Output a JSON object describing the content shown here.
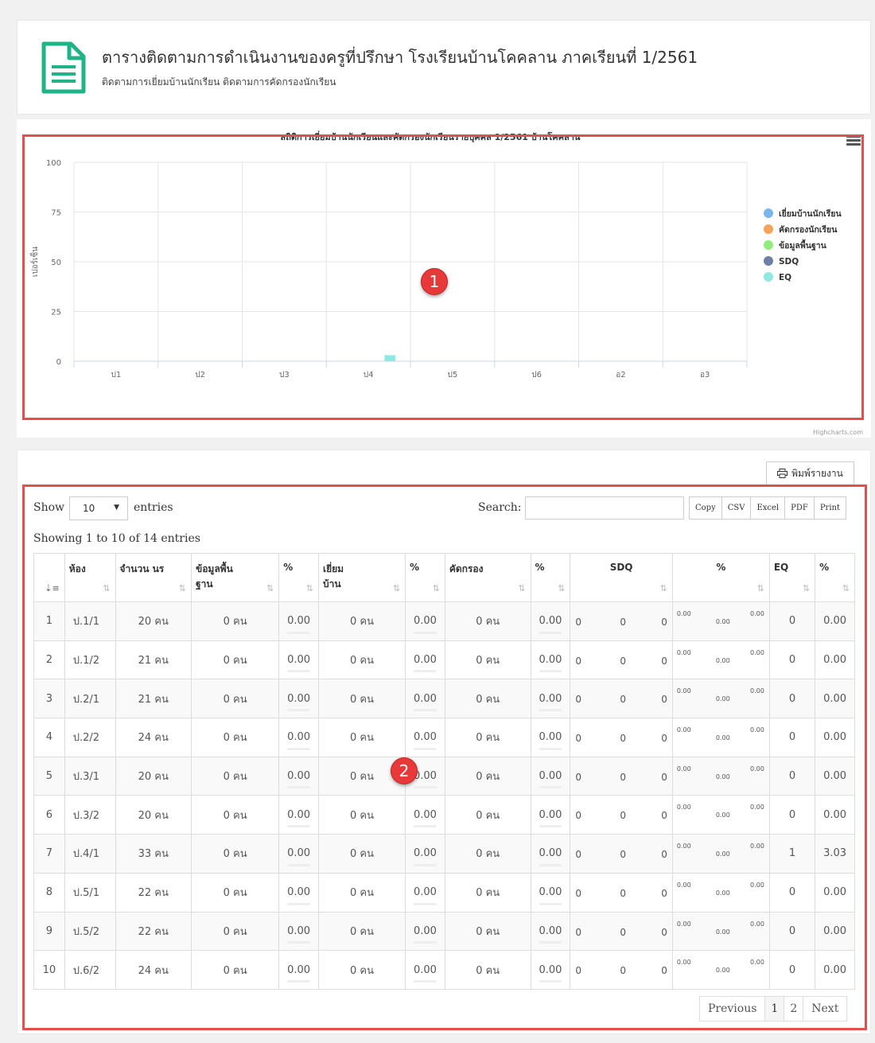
{
  "header": {
    "title": "ตารางติดตามการดำเนินงานของครูที่ปรึกษา โรงเรียนบ้านโคคลาน ภาคเรียนที่ 1/2561",
    "subtitle": "ติดตามการเยี่ยมบ้านนักเรียน ติดตามการคัดกรองนักเรียน",
    "icon": "document-icon",
    "icon_color": "#1fb387"
  },
  "chart_data": {
    "type": "bar",
    "title": "สถิติการเยี่ยมบ้านนักเรียนและคัดกรองนักเรียนรายบุคคล 1/2561 บ้านโคคลาน",
    "ylabel": "เปอร์เซ็น",
    "xlabel": "",
    "categories": [
      "ป1",
      "ป2",
      "ป3",
      "ป4",
      "ป5",
      "ป6",
      "อ2",
      "อ3"
    ],
    "ylim": [
      0,
      100
    ],
    "yticks": [
      0,
      25,
      50,
      75,
      100
    ],
    "grid": true,
    "legend_position": "right",
    "series": [
      {
        "name": "เยี่ยมบ้านนักเรียน",
        "color": "#7cb5ec",
        "values": [
          0,
          0,
          0,
          0,
          0,
          0,
          0,
          0
        ]
      },
      {
        "name": "คัดกรองนักเรียน",
        "color": "#f7a35c",
        "values": [
          0,
          0,
          0,
          0,
          0,
          0,
          0,
          0
        ]
      },
      {
        "name": "ข้อมูลพื้นฐาน",
        "color": "#90ed7d",
        "values": [
          0,
          0,
          0,
          0,
          0,
          0,
          0,
          0
        ]
      },
      {
        "name": "SDQ",
        "color": "#6d7fa3",
        "values": [
          0,
          0,
          0,
          0,
          0,
          0,
          0,
          0
        ]
      },
      {
        "name": "EQ",
        "color": "#91e8e1",
        "values": [
          0,
          0,
          0,
          3.03,
          0,
          0,
          0,
          0
        ]
      }
    ],
    "credits": "Highcharts.com"
  },
  "toolbar": {
    "print_report_label": "พิมพ์รายงาน",
    "show_label": "Show",
    "entries_value": "10",
    "entries_label": "entries",
    "search_label": "Search:",
    "search_value": "",
    "export_buttons": [
      "Copy",
      "CSV",
      "Excel",
      "PDF",
      "Print"
    ],
    "info": "Showing 1 to 10 of 14 entries"
  },
  "table": {
    "headers": {
      "no": "",
      "room": "ห้อง",
      "count": "จำนวน นร",
      "basic": "ข้อมูลพื้น ฐาน",
      "pct1": "%",
      "visit": "เยี่ยม บ้าน",
      "pct2": "%",
      "screen": "คัดกรอง",
      "pct3": "%",
      "sdq": "SDQ",
      "pct4": "%",
      "eq": "EQ",
      "pct5": "%"
    },
    "rows": [
      {
        "no": "1",
        "room": "ป.1/1",
        "count": "20 คน",
        "basic": "0 คน",
        "p1": "0.00",
        "visit": "0 คน",
        "p2": "0.00",
        "screen": "0 คน",
        "p3": "0.00",
        "sdq": [
          "0",
          "0",
          "0"
        ],
        "sdqp": [
          "0.00",
          "0.00",
          "0.00"
        ],
        "eq": "0",
        "eqp": "0.00"
      },
      {
        "no": "2",
        "room": "ป.1/2",
        "count": "21 คน",
        "basic": "0 คน",
        "p1": "0.00",
        "visit": "0 คน",
        "p2": "0.00",
        "screen": "0 คน",
        "p3": "0.00",
        "sdq": [
          "0",
          "0",
          "0"
        ],
        "sdqp": [
          "0.00",
          "0.00",
          "0.00"
        ],
        "eq": "0",
        "eqp": "0.00"
      },
      {
        "no": "3",
        "room": "ป.2/1",
        "count": "21 คน",
        "basic": "0 คน",
        "p1": "0.00",
        "visit": "0 คน",
        "p2": "0.00",
        "screen": "0 คน",
        "p3": "0.00",
        "sdq": [
          "0",
          "0",
          "0"
        ],
        "sdqp": [
          "0.00",
          "0.00",
          "0.00"
        ],
        "eq": "0",
        "eqp": "0.00"
      },
      {
        "no": "4",
        "room": "ป.2/2",
        "count": "24 คน",
        "basic": "0 คน",
        "p1": "0.00",
        "visit": "0 คน",
        "p2": "0.00",
        "screen": "0 คน",
        "p3": "0.00",
        "sdq": [
          "0",
          "0",
          "0"
        ],
        "sdqp": [
          "0.00",
          "0.00",
          "0.00"
        ],
        "eq": "0",
        "eqp": "0.00"
      },
      {
        "no": "5",
        "room": "ป.3/1",
        "count": "20 คน",
        "basic": "0 คน",
        "p1": "0.00",
        "visit": "0 คน",
        "p2": "0.00",
        "screen": "0 คน",
        "p3": "0.00",
        "sdq": [
          "0",
          "0",
          "0"
        ],
        "sdqp": [
          "0.00",
          "0.00",
          "0.00"
        ],
        "eq": "0",
        "eqp": "0.00"
      },
      {
        "no": "6",
        "room": "ป.3/2",
        "count": "20 คน",
        "basic": "0 คน",
        "p1": "0.00",
        "visit": "0 คน",
        "p2": "0.00",
        "screen": "0 คน",
        "p3": "0.00",
        "sdq": [
          "0",
          "0",
          "0"
        ],
        "sdqp": [
          "0.00",
          "0.00",
          "0.00"
        ],
        "eq": "0",
        "eqp": "0.00"
      },
      {
        "no": "7",
        "room": "ป.4/1",
        "count": "33 คน",
        "basic": "0 คน",
        "p1": "0.00",
        "visit": "0 คน",
        "p2": "0.00",
        "screen": "0 คน",
        "p3": "0.00",
        "sdq": [
          "0",
          "0",
          "0"
        ],
        "sdqp": [
          "0.00",
          "0.00",
          "0.00"
        ],
        "eq": "1",
        "eqp": "3.03"
      },
      {
        "no": "8",
        "room": "ป.5/1",
        "count": "22 คน",
        "basic": "0 คน",
        "p1": "0.00",
        "visit": "0 คน",
        "p2": "0.00",
        "screen": "0 คน",
        "p3": "0.00",
        "sdq": [
          "0",
          "0",
          "0"
        ],
        "sdqp": [
          "0.00",
          "0.00",
          "0.00"
        ],
        "eq": "0",
        "eqp": "0.00"
      },
      {
        "no": "9",
        "room": "ป.5/2",
        "count": "22 คน",
        "basic": "0 คน",
        "p1": "0.00",
        "visit": "0 คน",
        "p2": "0.00",
        "screen": "0 คน",
        "p3": "0.00",
        "sdq": [
          "0",
          "0",
          "0"
        ],
        "sdqp": [
          "0.00",
          "0.00",
          "0.00"
        ],
        "eq": "0",
        "eqp": "0.00"
      },
      {
        "no": "10",
        "room": "ป.6/2",
        "count": "24 คน",
        "basic": "0 คน",
        "p1": "0.00",
        "visit": "0 คน",
        "p2": "0.00",
        "screen": "0 คน",
        "p3": "0.00",
        "sdq": [
          "0",
          "0",
          "0"
        ],
        "sdqp": [
          "0.00",
          "0.00",
          "0.00"
        ],
        "eq": "0",
        "eqp": "0.00"
      }
    ]
  },
  "pagination": {
    "previous": "Previous",
    "pages": [
      "1",
      "2"
    ],
    "next": "Next"
  },
  "annotations": {
    "labels": [
      "1",
      "2"
    ],
    "color": "#e14f4f"
  }
}
